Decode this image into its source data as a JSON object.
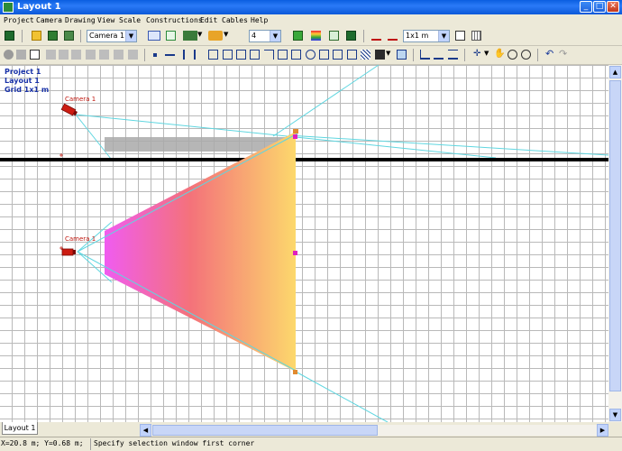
{
  "window": {
    "title": "Layout 1"
  },
  "menu": [
    "Project",
    "Camera",
    "Drawing",
    "View",
    "Scale",
    "Constructions",
    "Edit",
    "Cables",
    "Help"
  ],
  "toolbar": {
    "camera_select": "Camera 1",
    "number_select": "4",
    "grid_select": "1x1 m"
  },
  "canvas": {
    "project": "Project 1",
    "layout": "Layout 1",
    "grid": "Grid 1x1 m",
    "camera_top_label": "Camera 1",
    "camera_bottom_label": "Camera 1"
  },
  "tabs": [
    "Layout 1"
  ],
  "status": {
    "coords": "X=20.8 m; Y=0.68 m;",
    "message": "Specify selection window first corner"
  },
  "colors": {
    "title_blue": "#0a5ee0",
    "grid_line": "#b9b9b9",
    "cyan_ray": "#5fd6e0",
    "camera_red": "#cc1c12",
    "fov_start": "#f05cf0",
    "fov_mid": "#f4727a",
    "fov_end": "#fcd86c",
    "info_text": "#1a33a8"
  }
}
